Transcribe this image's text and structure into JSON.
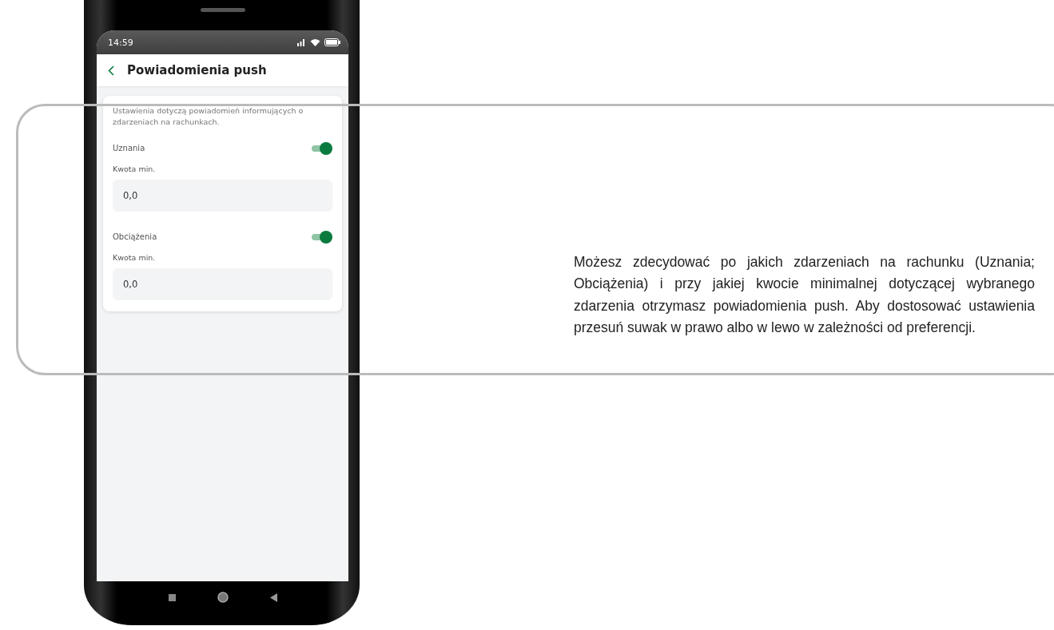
{
  "status_bar": {
    "time": "14:59"
  },
  "header": {
    "title": "Powiadomienia push"
  },
  "card": {
    "description": "Ustawienia dotyczą powiadomień informujących o zdarzeniach na rachunkach.",
    "sections": [
      {
        "label": "Uznania",
        "on": true,
        "amount_label": "Kwota min.",
        "amount": "0,0"
      },
      {
        "label": "Obciążenia",
        "on": true,
        "amount_label": "Kwota min.",
        "amount": "0,0"
      }
    ]
  },
  "callout": {
    "text": "Możesz zdecydować po jakich zdarzeniach na rachunku (Uznania; Obciążenia) i przy jakiej kwocie minimalnej dotyczącej wybranego zdarzenia otrzymasz powiadomienia push. Aby dostosować ustawienia przesuń suwak w prawo albo w lewo w zależności od preferencji."
  }
}
